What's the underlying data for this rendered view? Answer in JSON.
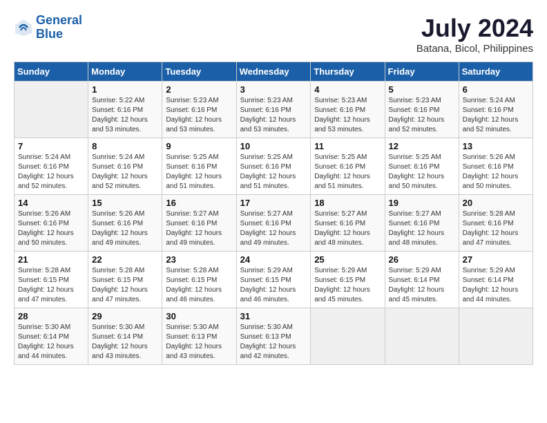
{
  "header": {
    "logo_line1": "General",
    "logo_line2": "Blue",
    "month": "July 2024",
    "location": "Batana, Bicol, Philippines"
  },
  "columns": [
    "Sunday",
    "Monday",
    "Tuesday",
    "Wednesday",
    "Thursday",
    "Friday",
    "Saturday"
  ],
  "weeks": [
    [
      {
        "day": "",
        "info": ""
      },
      {
        "day": "1",
        "info": "Sunrise: 5:22 AM\nSunset: 6:16 PM\nDaylight: 12 hours\nand 53 minutes."
      },
      {
        "day": "2",
        "info": "Sunrise: 5:23 AM\nSunset: 6:16 PM\nDaylight: 12 hours\nand 53 minutes."
      },
      {
        "day": "3",
        "info": "Sunrise: 5:23 AM\nSunset: 6:16 PM\nDaylight: 12 hours\nand 53 minutes."
      },
      {
        "day": "4",
        "info": "Sunrise: 5:23 AM\nSunset: 6:16 PM\nDaylight: 12 hours\nand 53 minutes."
      },
      {
        "day": "5",
        "info": "Sunrise: 5:23 AM\nSunset: 6:16 PM\nDaylight: 12 hours\nand 52 minutes."
      },
      {
        "day": "6",
        "info": "Sunrise: 5:24 AM\nSunset: 6:16 PM\nDaylight: 12 hours\nand 52 minutes."
      }
    ],
    [
      {
        "day": "7",
        "info": "Sunrise: 5:24 AM\nSunset: 6:16 PM\nDaylight: 12 hours\nand 52 minutes."
      },
      {
        "day": "8",
        "info": "Sunrise: 5:24 AM\nSunset: 6:16 PM\nDaylight: 12 hours\nand 52 minutes."
      },
      {
        "day": "9",
        "info": "Sunrise: 5:25 AM\nSunset: 6:16 PM\nDaylight: 12 hours\nand 51 minutes."
      },
      {
        "day": "10",
        "info": "Sunrise: 5:25 AM\nSunset: 6:16 PM\nDaylight: 12 hours\nand 51 minutes."
      },
      {
        "day": "11",
        "info": "Sunrise: 5:25 AM\nSunset: 6:16 PM\nDaylight: 12 hours\nand 51 minutes."
      },
      {
        "day": "12",
        "info": "Sunrise: 5:25 AM\nSunset: 6:16 PM\nDaylight: 12 hours\nand 50 minutes."
      },
      {
        "day": "13",
        "info": "Sunrise: 5:26 AM\nSunset: 6:16 PM\nDaylight: 12 hours\nand 50 minutes."
      }
    ],
    [
      {
        "day": "14",
        "info": "Sunrise: 5:26 AM\nSunset: 6:16 PM\nDaylight: 12 hours\nand 50 minutes."
      },
      {
        "day": "15",
        "info": "Sunrise: 5:26 AM\nSunset: 6:16 PM\nDaylight: 12 hours\nand 49 minutes."
      },
      {
        "day": "16",
        "info": "Sunrise: 5:27 AM\nSunset: 6:16 PM\nDaylight: 12 hours\nand 49 minutes."
      },
      {
        "day": "17",
        "info": "Sunrise: 5:27 AM\nSunset: 6:16 PM\nDaylight: 12 hours\nand 49 minutes."
      },
      {
        "day": "18",
        "info": "Sunrise: 5:27 AM\nSunset: 6:16 PM\nDaylight: 12 hours\nand 48 minutes."
      },
      {
        "day": "19",
        "info": "Sunrise: 5:27 AM\nSunset: 6:16 PM\nDaylight: 12 hours\nand 48 minutes."
      },
      {
        "day": "20",
        "info": "Sunrise: 5:28 AM\nSunset: 6:16 PM\nDaylight: 12 hours\nand 47 minutes."
      }
    ],
    [
      {
        "day": "21",
        "info": "Sunrise: 5:28 AM\nSunset: 6:15 PM\nDaylight: 12 hours\nand 47 minutes."
      },
      {
        "day": "22",
        "info": "Sunrise: 5:28 AM\nSunset: 6:15 PM\nDaylight: 12 hours\nand 47 minutes."
      },
      {
        "day": "23",
        "info": "Sunrise: 5:28 AM\nSunset: 6:15 PM\nDaylight: 12 hours\nand 46 minutes."
      },
      {
        "day": "24",
        "info": "Sunrise: 5:29 AM\nSunset: 6:15 PM\nDaylight: 12 hours\nand 46 minutes."
      },
      {
        "day": "25",
        "info": "Sunrise: 5:29 AM\nSunset: 6:15 PM\nDaylight: 12 hours\nand 45 minutes."
      },
      {
        "day": "26",
        "info": "Sunrise: 5:29 AM\nSunset: 6:14 PM\nDaylight: 12 hours\nand 45 minutes."
      },
      {
        "day": "27",
        "info": "Sunrise: 5:29 AM\nSunset: 6:14 PM\nDaylight: 12 hours\nand 44 minutes."
      }
    ],
    [
      {
        "day": "28",
        "info": "Sunrise: 5:30 AM\nSunset: 6:14 PM\nDaylight: 12 hours\nand 44 minutes."
      },
      {
        "day": "29",
        "info": "Sunrise: 5:30 AM\nSunset: 6:14 PM\nDaylight: 12 hours\nand 43 minutes."
      },
      {
        "day": "30",
        "info": "Sunrise: 5:30 AM\nSunset: 6:13 PM\nDaylight: 12 hours\nand 43 minutes."
      },
      {
        "day": "31",
        "info": "Sunrise: 5:30 AM\nSunset: 6:13 PM\nDaylight: 12 hours\nand 42 minutes."
      },
      {
        "day": "",
        "info": ""
      },
      {
        "day": "",
        "info": ""
      },
      {
        "day": "",
        "info": ""
      }
    ]
  ]
}
